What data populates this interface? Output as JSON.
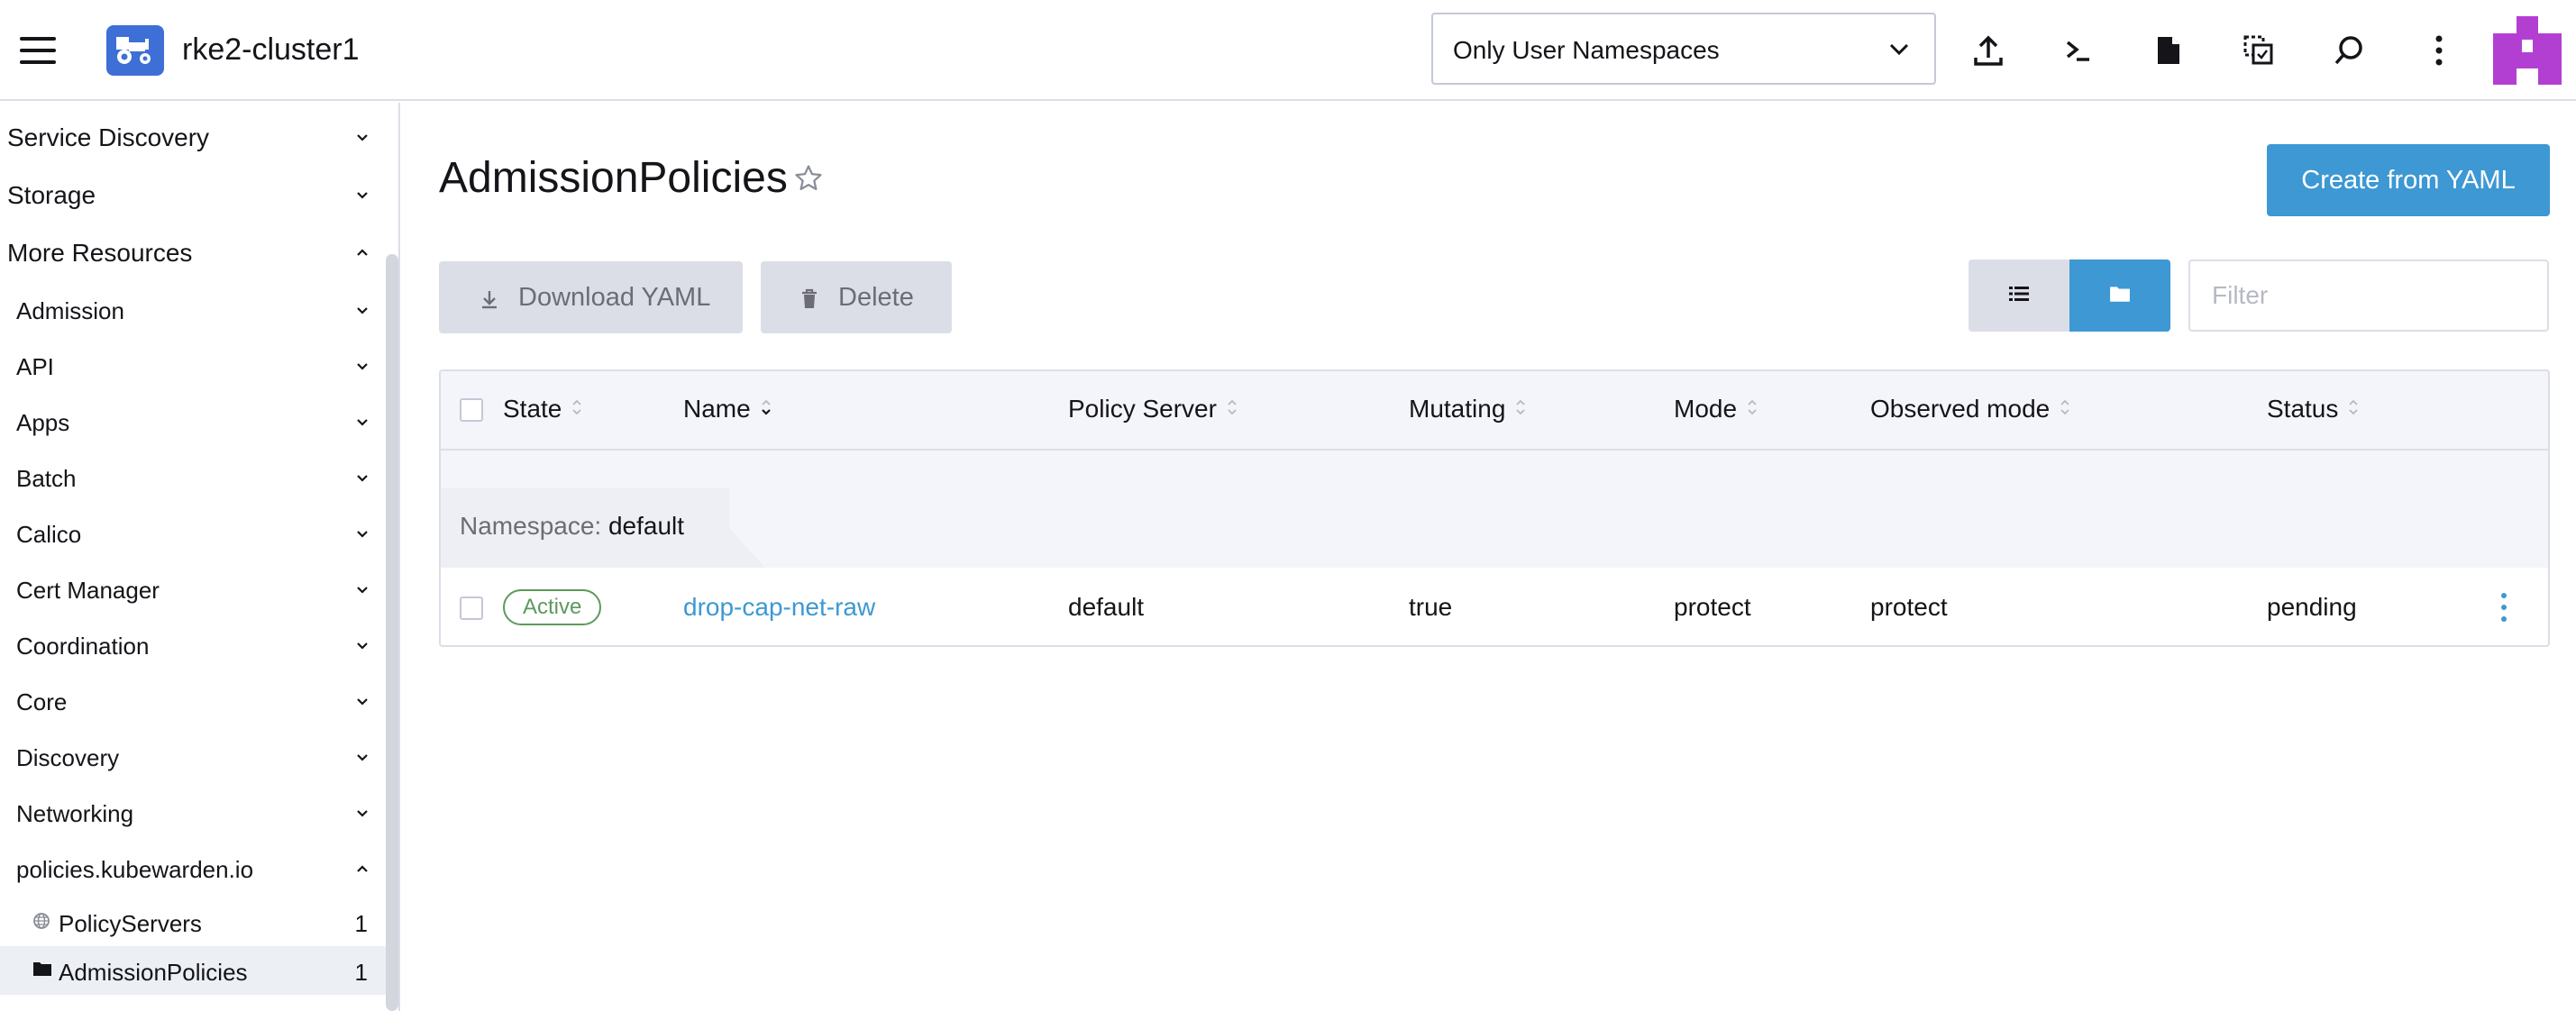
{
  "header": {
    "cluster_name": "rke2-cluster1",
    "namespace_filter": "Only User Namespaces",
    "icons": [
      "upload-icon",
      "kubectl-shell-icon",
      "file-icon",
      "copy-kubeconfig-icon",
      "search-icon",
      "more-options-icon"
    ]
  },
  "sidebar": {
    "groups_top": [
      {
        "label": "Service Discovery",
        "expanded": false
      },
      {
        "label": "Storage",
        "expanded": false
      },
      {
        "label": "More Resources",
        "expanded": true
      }
    ],
    "subgroups": [
      {
        "label": "Admission"
      },
      {
        "label": "API"
      },
      {
        "label": "Apps"
      },
      {
        "label": "Batch"
      },
      {
        "label": "Calico"
      },
      {
        "label": "Cert Manager"
      },
      {
        "label": "Coordination"
      },
      {
        "label": "Core"
      },
      {
        "label": "Discovery"
      },
      {
        "label": "Networking"
      },
      {
        "label": "policies.kubewarden.io"
      }
    ],
    "items": [
      {
        "label": "PolicyServers",
        "count": "1",
        "icon": "globe-icon",
        "active": false
      },
      {
        "label": "AdmissionPolicies",
        "count": "1",
        "icon": "folder-icon",
        "active": true
      }
    ]
  },
  "main": {
    "title": "AdmissionPolicies",
    "create_button": "Create from YAML",
    "download_button": "Download YAML",
    "delete_button": "Delete",
    "filter_placeholder": "Filter",
    "columns": [
      "State",
      "Name",
      "Policy Server",
      "Mutating",
      "Mode",
      "Observed mode",
      "Status"
    ],
    "group": {
      "label": "Namespace:",
      "value": "default"
    },
    "rows": [
      {
        "state": "Active",
        "name": "drop-cap-net-raw",
        "policy_server": "default",
        "mutating": "true",
        "mode": "protect",
        "observed_mode": "protect",
        "status": "pending"
      }
    ]
  },
  "colors": {
    "primary": "#3d98d3",
    "active_badge": "#5d995d",
    "avatar": "#b33fd2",
    "cluster_logo": "#3d6fd6"
  }
}
